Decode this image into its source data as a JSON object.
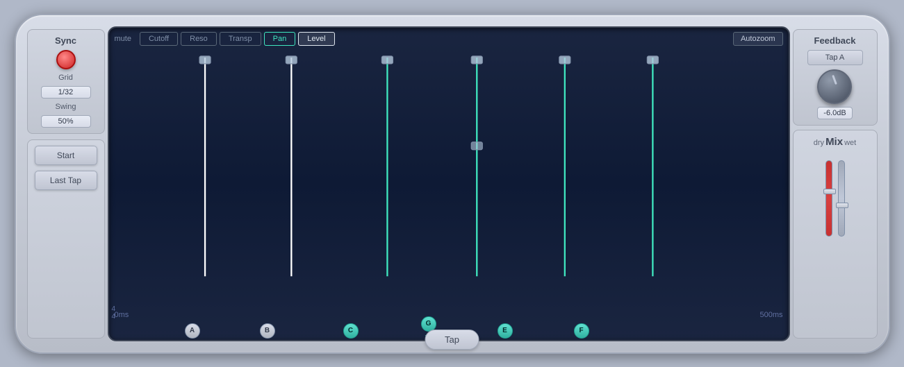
{
  "device": {
    "left": {
      "sync_label": "Sync",
      "grid_label": "Grid",
      "grid_value": "1/32",
      "swing_label": "Swing",
      "swing_value": "50%",
      "start_label": "Start",
      "last_tap_label": "Last Tap"
    },
    "display": {
      "mute_label": "mute",
      "tabs": [
        {
          "label": "Cutoff",
          "active": false
        },
        {
          "label": "Reso",
          "active": false
        },
        {
          "label": "Transp",
          "active": false
        },
        {
          "label": "Pan",
          "active": false
        },
        {
          "label": "Level",
          "active": true
        }
      ],
      "autozoom_label": "Autozoom",
      "time_start": "0ms",
      "time_end": "500ms",
      "time_sig": "4\n4",
      "taps": [
        {
          "label": "A",
          "type": "white",
          "pos_pct": 14
        },
        {
          "label": "B",
          "type": "white",
          "pos_pct": 27
        },
        {
          "label": "C",
          "type": "cyan",
          "pos_pct": 41
        },
        {
          "label": "G",
          "type": "cyan",
          "pos_pct": 54
        },
        {
          "label": "E",
          "type": "cyan",
          "pos_pct": 67
        },
        {
          "label": "F",
          "type": "cyan",
          "pos_pct": 80
        }
      ]
    },
    "right": {
      "feedback_label": "Feedback",
      "tap_a_label": "Tap A",
      "knob_value": "-6.0dB",
      "mix_label": "Mix",
      "mix_dry": "dry",
      "mix_wet": "wet"
    }
  }
}
